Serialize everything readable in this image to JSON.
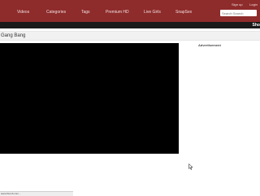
{
  "nav": {
    "items": [
      {
        "label": "Videos"
      },
      {
        "label": "Categories"
      },
      {
        "label": "Tags"
      },
      {
        "label": "Premium HD"
      },
      {
        "label": "Live Girls"
      },
      {
        "label": "SnapSex"
      }
    ],
    "signup_label": "Sign up",
    "login_label": "Login",
    "search_placeholder": "Search Search"
  },
  "subbar": {
    "text": "Sho"
  },
  "page": {
    "title": "Gang Bang"
  },
  "sidebar": {
    "ad_label": "Advertisement"
  },
  "status": {
    "text": "www.thumb.com..."
  },
  "colors": {
    "brand": "#8e2b2b",
    "subbar": "#1a1a1a",
    "player": "#000000"
  }
}
